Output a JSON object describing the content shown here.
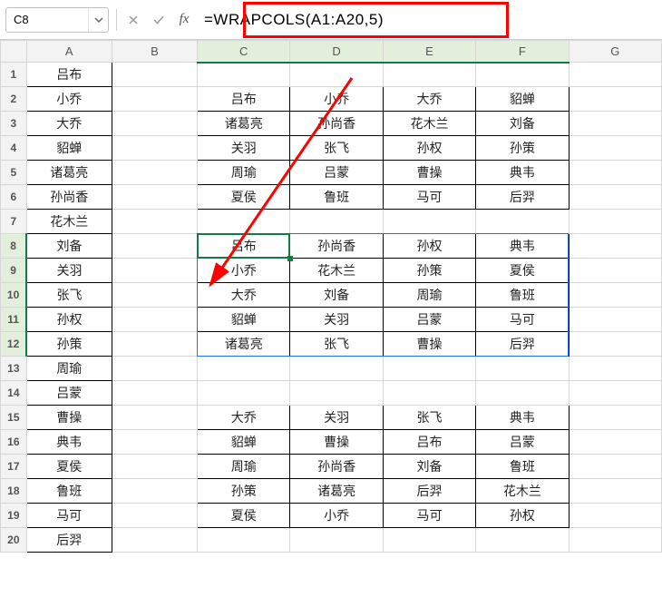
{
  "nameBox": {
    "value": "C8"
  },
  "formula": {
    "value": "=WRAPCOLS(A1:A20,5)"
  },
  "columns": [
    "A",
    "B",
    "C",
    "D",
    "E",
    "F",
    "G"
  ],
  "rowCount": 20,
  "colA": [
    "吕布",
    "小乔",
    "大乔",
    "貂蝉",
    "诸葛亮",
    "孙尚香",
    "花木兰",
    "刘备",
    "关羽",
    "张飞",
    "孙权",
    "孙策",
    "周瑜",
    "吕蒙",
    "曹操",
    "典韦",
    "夏侯",
    "鲁班",
    "马可",
    "后羿"
  ],
  "block1": {
    "rows": [
      [
        "吕布",
        "小乔",
        "大乔",
        "貂蝉"
      ],
      [
        "诸葛亮",
        "孙尚香",
        "花木兰",
        "刘备"
      ],
      [
        "关羽",
        "张飞",
        "孙权",
        "孙策"
      ],
      [
        "周瑜",
        "吕蒙",
        "曹操",
        "典韦"
      ],
      [
        "夏侯",
        "鲁班",
        "马可",
        "后羿"
      ]
    ]
  },
  "block2": {
    "rows": [
      [
        "吕布",
        "孙尚香",
        "孙权",
        "典韦"
      ],
      [
        "小乔",
        "花木兰",
        "孙策",
        "夏侯"
      ],
      [
        "大乔",
        "刘备",
        "周瑜",
        "鲁班"
      ],
      [
        "貂蝉",
        "关羽",
        "吕蒙",
        "马可"
      ],
      [
        "诸葛亮",
        "张飞",
        "曹操",
        "后羿"
      ]
    ]
  },
  "block3": {
    "rows": [
      [
        "大乔",
        "关羽",
        "张飞",
        "典韦"
      ],
      [
        "貂蝉",
        "曹操",
        "吕布",
        "吕蒙"
      ],
      [
        "周瑜",
        "孙尚香",
        "刘备",
        "鲁班"
      ],
      [
        "孙策",
        "诸葛亮",
        "后羿",
        "花木兰"
      ],
      [
        "夏侯",
        "小乔",
        "马可",
        "孙权"
      ]
    ]
  },
  "icons": {
    "fx": "fx",
    "check": "✓",
    "cancel": "✕",
    "chevronDown": "▾"
  }
}
